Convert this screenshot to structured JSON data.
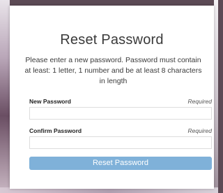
{
  "form": {
    "title": "Reset Password",
    "description": "Please enter a new password. Password must contain at least: 1 letter, 1 number and be at least 8 characters in length",
    "new_password": {
      "label": "New Password",
      "required_text": "Required",
      "value": "",
      "placeholder": ""
    },
    "confirm_password": {
      "label": "Confirm Password",
      "required_text": "Required",
      "value": "",
      "placeholder": ""
    },
    "submit_label": "Reset Password"
  },
  "colors": {
    "button": "#7fb1d9",
    "button_text": "#ffffff",
    "text": "#3a3a3a"
  }
}
